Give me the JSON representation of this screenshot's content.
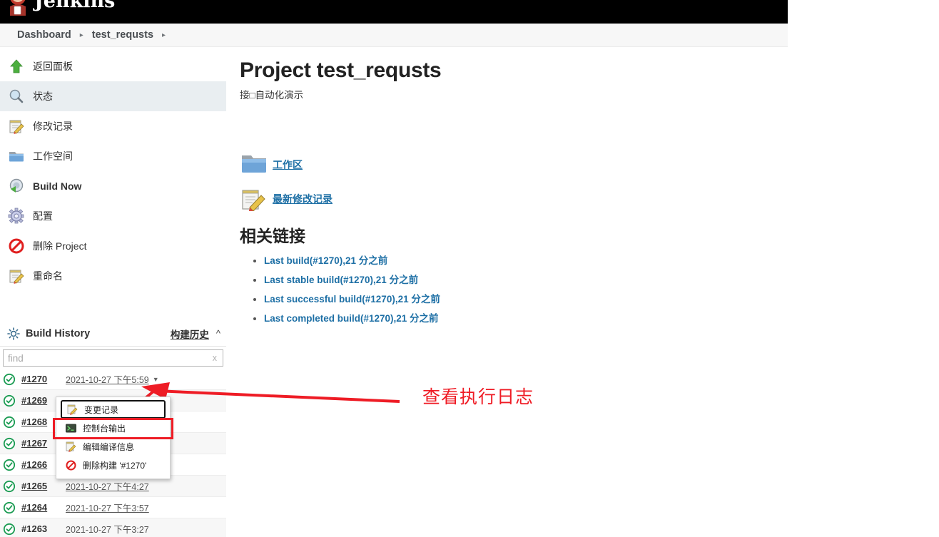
{
  "header": {
    "brand": "Jenkins",
    "brand_icon": "jenkins-butler-logo"
  },
  "breadcrumb": {
    "items": [
      "Dashboard",
      "test_requsts"
    ],
    "separator": "▸"
  },
  "sidebar": {
    "items": [
      {
        "label": "返回面板",
        "icon": "up-arrow-icon",
        "selected": false
      },
      {
        "label": "状态",
        "icon": "magnifier-icon",
        "selected": true
      },
      {
        "label": "修改记录",
        "icon": "notepad-pencil-icon",
        "selected": false
      },
      {
        "label": "工作空间",
        "icon": "folder-icon",
        "selected": false
      },
      {
        "label": "Build Now",
        "icon": "build-now-icon",
        "selected": false
      },
      {
        "label": "配置",
        "icon": "gear-icon",
        "selected": false
      },
      {
        "label": "删除 Project",
        "icon": "no-entry-icon",
        "selected": false
      },
      {
        "label": "重命名",
        "icon": "notepad-pencil-icon",
        "selected": false
      }
    ]
  },
  "build_history": {
    "icon": "sun-gear-icon",
    "title": "Build History",
    "link_label": "构建历史",
    "collapse_icon": "chevron-up-icon",
    "search": {
      "placeholder": "find",
      "value": "",
      "clear_label": "x"
    },
    "rows": [
      {
        "number": "#1270",
        "date": "2021-10-27 下午5:59",
        "status": "success",
        "has_caret": true
      },
      {
        "number": "#1269",
        "date": "",
        "status": "success",
        "has_caret": false
      },
      {
        "number": "#1268",
        "date": "",
        "status": "success",
        "has_caret": false
      },
      {
        "number": "#1267",
        "date": "",
        "status": "success",
        "has_caret": false
      },
      {
        "number": "#1266",
        "date": "",
        "status": "success",
        "has_caret": false
      },
      {
        "number": "#1265",
        "date": "2021-10-27 下午4:27",
        "status": "success",
        "has_caret": false
      },
      {
        "number": "#1264",
        "date": "2021-10-27 下午3:57",
        "status": "success",
        "has_caret": false
      },
      {
        "number": "#1263",
        "date": "2021-10-27 下午3:27",
        "status": "success",
        "has_caret": false
      }
    ]
  },
  "context_menu": {
    "items": [
      {
        "label": "变更记录",
        "icon": "notepad-pencil-icon",
        "focused": true,
        "highlighted": false
      },
      {
        "label": "控制台输出",
        "icon": "console-terminal-icon",
        "focused": false,
        "highlighted": true
      },
      {
        "label": "编辑编译信息",
        "icon": "notepad-pencil-icon",
        "focused": false,
        "highlighted": false
      },
      {
        "label": "删除构建 '#1270'",
        "icon": "no-entry-icon",
        "focused": false,
        "highlighted": false
      }
    ]
  },
  "main": {
    "title": "Project test_requsts",
    "description": "接□自动化演示",
    "quick_links": [
      {
        "label": "工作区",
        "icon": "folder-icon"
      },
      {
        "label": "最新修改记录",
        "icon": "notepad-pencil-icon"
      }
    ],
    "related_heading": "相关链接",
    "related_links": [
      "Last build(#1270),21 分之前",
      "Last stable build(#1270),21 分之前",
      "Last successful build(#1270),21 分之前",
      "Last completed build(#1270),21 分之前"
    ]
  },
  "annotations": {
    "note": "查看执行日志",
    "color": "#ef1b24"
  }
}
